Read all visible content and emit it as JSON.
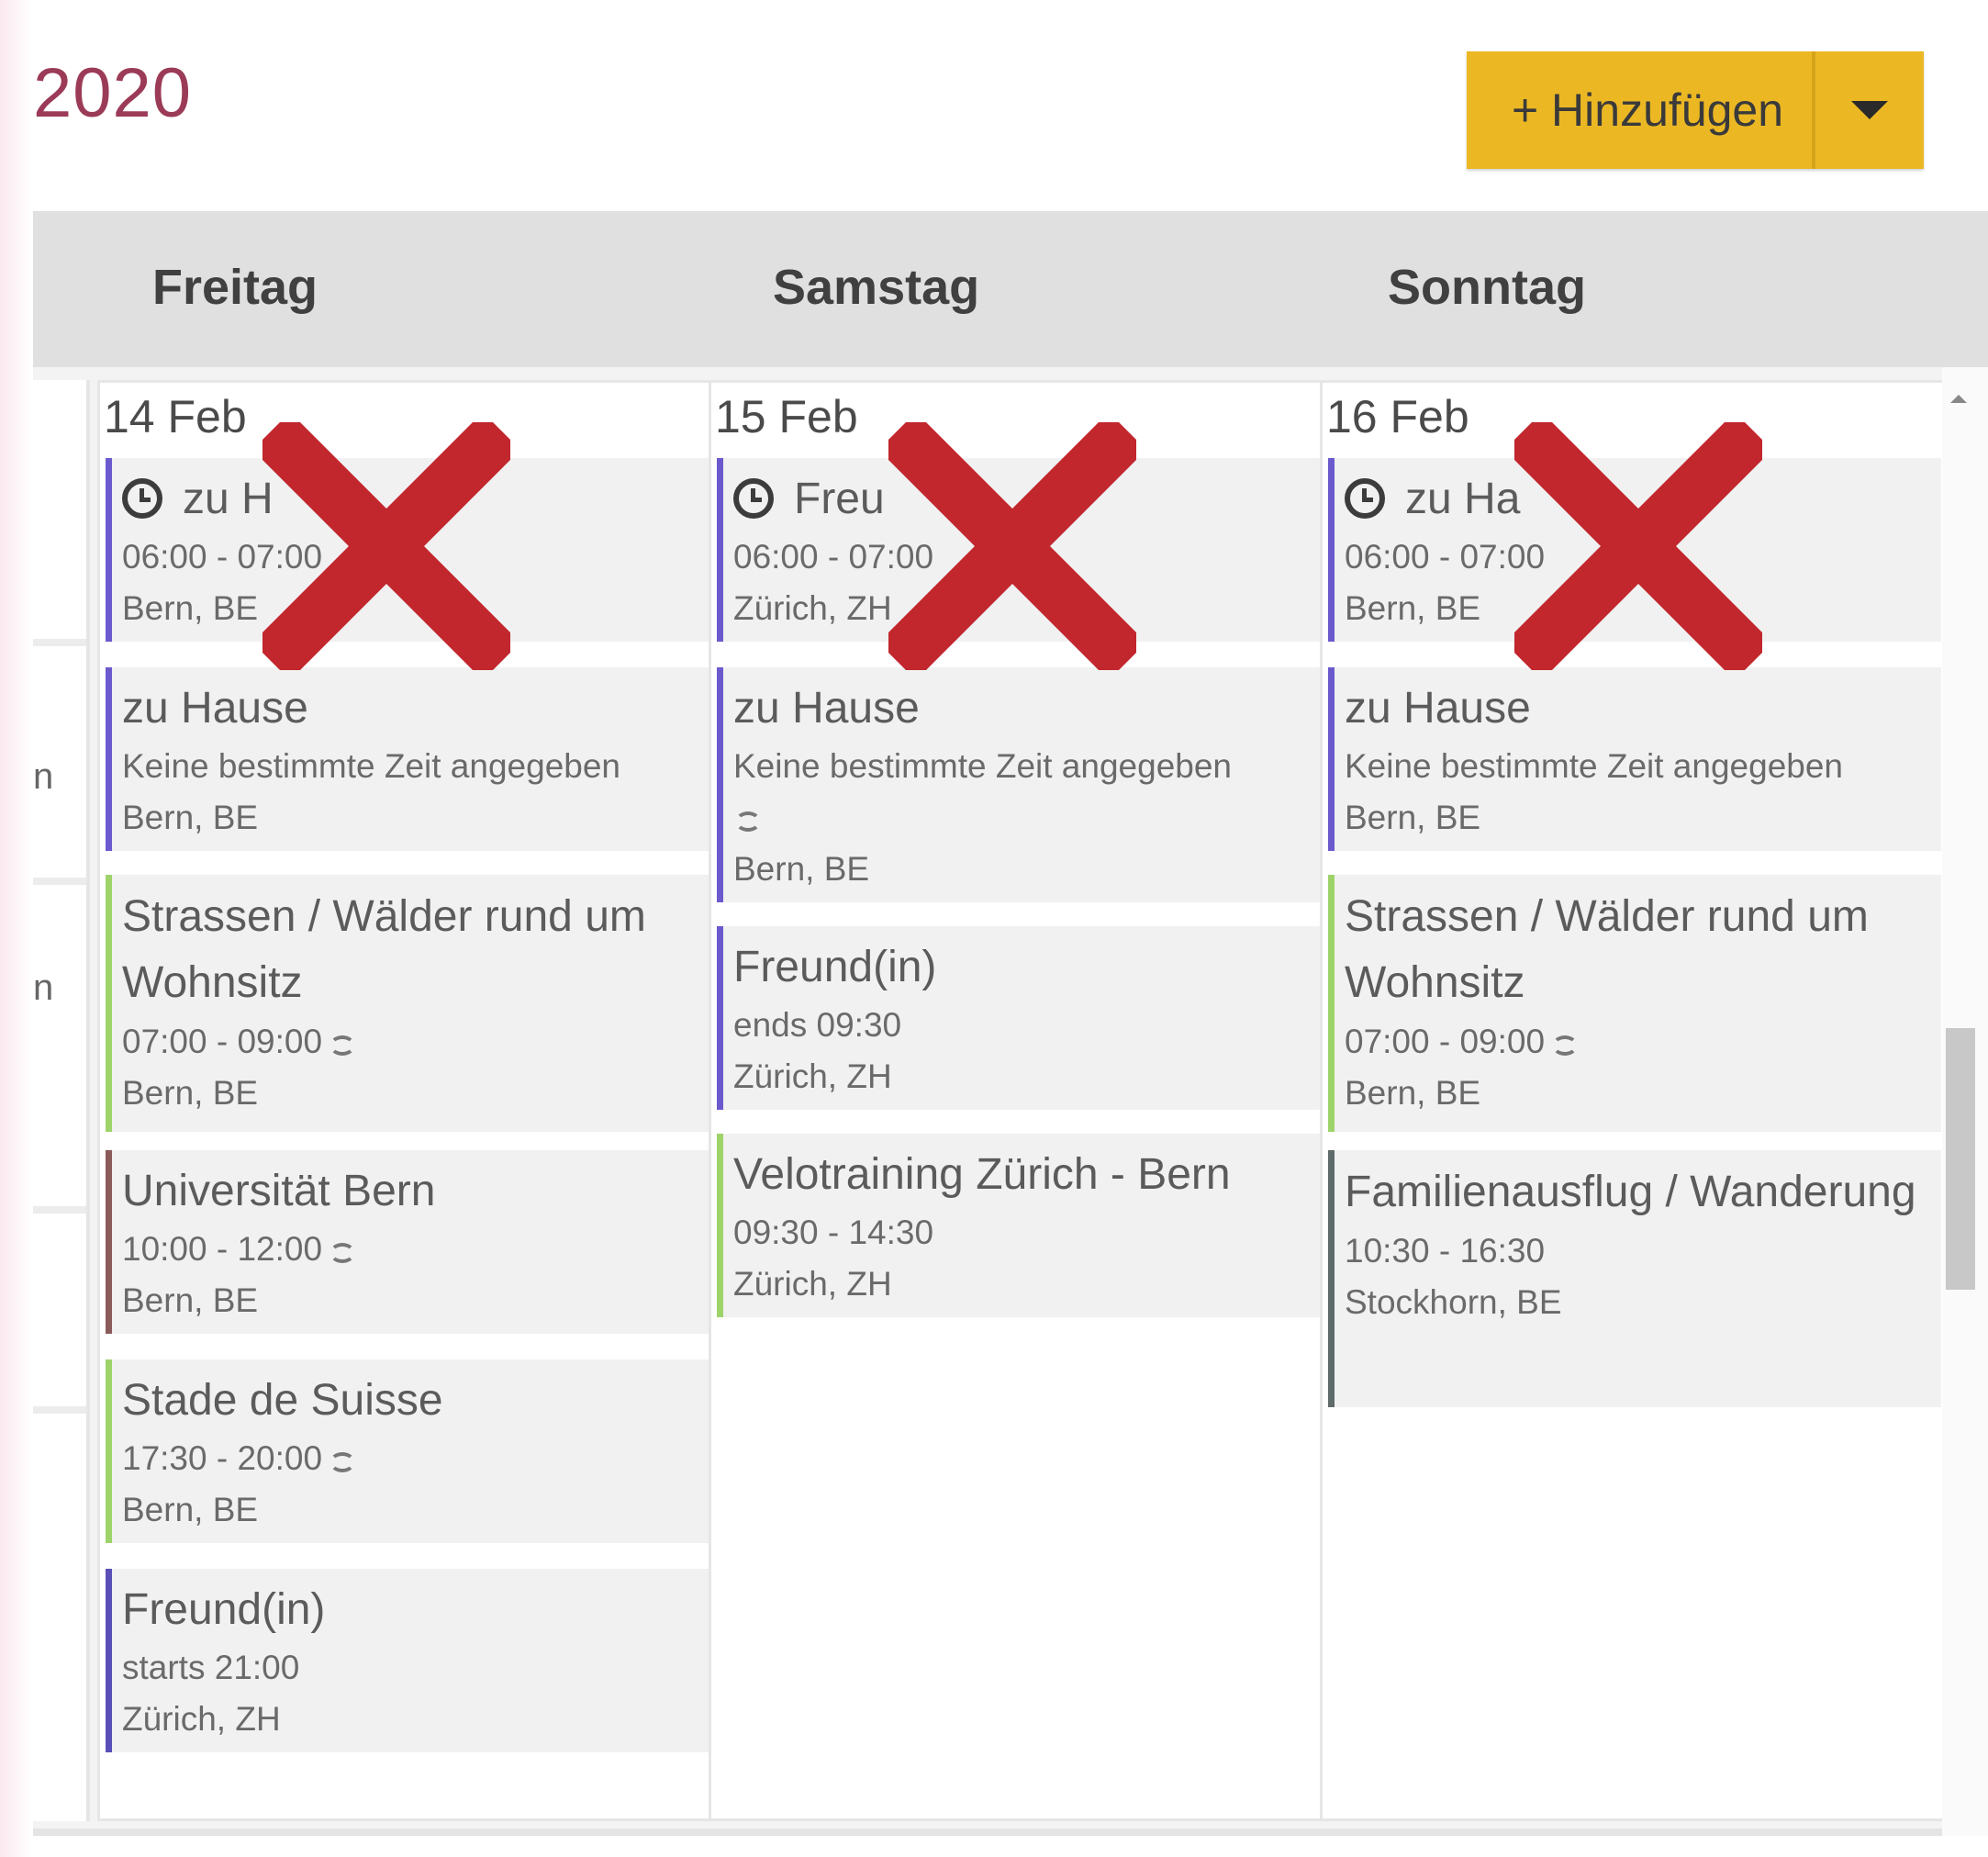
{
  "header": {
    "title": "2020",
    "add_button_label": "+ Hinzufügen",
    "add_button_color": "#ebb824"
  },
  "days": [
    {
      "name": "Freitag",
      "date": "14 Feb"
    },
    {
      "name": "Samstag",
      "date": "15 Feb"
    },
    {
      "name": "Sonntag",
      "date": "16 Feb"
    }
  ],
  "stub_texts": [
    "n",
    "n"
  ],
  "events": {
    "friday": [
      {
        "title": "zu H",
        "time": "06:00 - 07:00",
        "place": "Bern, BE",
        "icon": "clock-icon",
        "color": "#6a5acd"
      },
      {
        "title": "zu Hause",
        "time": "Keine bestimmte Zeit angegeben",
        "place": "Bern, BE",
        "color": "#6a5acd"
      },
      {
        "title": "Strassen / Wälder rund um Wohnsitz",
        "time": "07:00 - 09:00",
        "place": "Bern, BE",
        "repeat": true,
        "color": "#9ed36a"
      },
      {
        "title": "Universität Bern",
        "time": "10:00 - 12:00",
        "place": "Bern, BE",
        "repeat": true,
        "color": "#8b5a5a"
      },
      {
        "title": "Stade de Suisse",
        "time": "17:30 - 20:00",
        "place": "Bern, BE",
        "repeat": true,
        "color": "#9ed36a"
      },
      {
        "title": "Freund(in)",
        "time": "starts 21:00",
        "place": "Zürich, ZH",
        "color": "#5a4fb8"
      }
    ],
    "saturday": [
      {
        "title": "Freu",
        "time": "06:00 - 07:00",
        "place": "Zürich, ZH",
        "icon": "clock-icon",
        "color": "#6a5acd"
      },
      {
        "title": "zu Hause",
        "time": "Keine bestimmte Zeit angegeben",
        "place": "Bern, BE",
        "repeat": true,
        "color": "#6a5acd"
      },
      {
        "title": "Freund(in)",
        "time": "ends 09:30",
        "place": "Zürich, ZH",
        "color": "#6a5acd"
      },
      {
        "title": "Velotraining Zürich - Bern",
        "time": "09:30 - 14:30",
        "place": "Zürich, ZH",
        "color": "#9ed36a"
      }
    ],
    "sunday": [
      {
        "title": "zu Ha",
        "time": "06:00 - 07:00",
        "place": "Bern, BE",
        "icon": "clock-icon",
        "color": "#6a5acd"
      },
      {
        "title": "zu Hause",
        "time": "Keine bestimmte Zeit angegeben",
        "place": "Bern, BE",
        "color": "#6a5acd"
      },
      {
        "title": "Strassen / Wälder rund um Wohnsitz",
        "time": "07:00 - 09:00",
        "place": "Bern, BE",
        "repeat": true,
        "color": "#9ed36a"
      },
      {
        "title": "Familienausflug / Wanderung",
        "time": "10:30 - 16:30",
        "place": "Stockhorn, BE",
        "color": "#5f6a6a"
      }
    ]
  },
  "x_mark_color": "#c1272d"
}
